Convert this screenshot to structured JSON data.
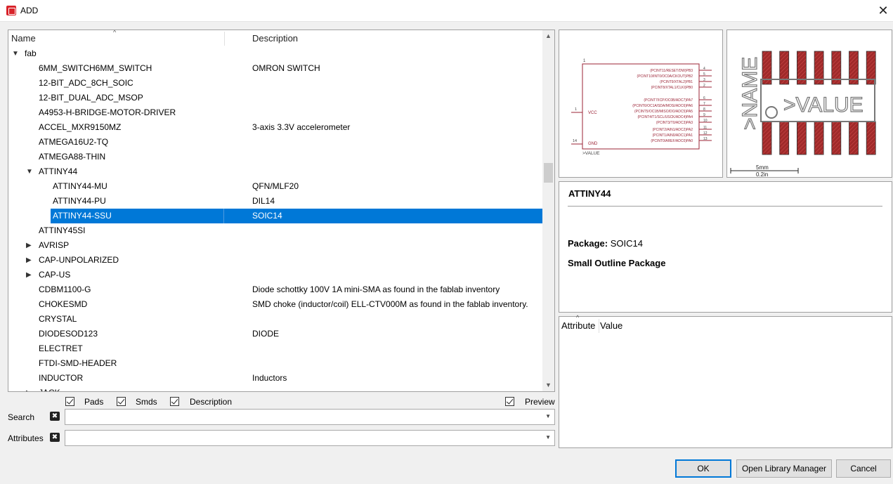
{
  "window": {
    "title": "ADD",
    "icon": "eagle-app-icon",
    "close": "✕"
  },
  "tree": {
    "columns": {
      "name": "Name",
      "description": "Description"
    },
    "rows": [
      {
        "name": "fab",
        "desc": "",
        "level": 0,
        "arrow": "down"
      },
      {
        "name": "6MM_SWITCH6MM_SWITCH",
        "desc": "OMRON SWITCH",
        "level": 1
      },
      {
        "name": "12-BIT_ADC_8CH_SOIC",
        "desc": "",
        "level": 1
      },
      {
        "name": "12-BIT_DUAL_ADC_MSOP",
        "desc": "",
        "level": 1
      },
      {
        "name": "A4953-H-BRIDGE-MOTOR-DRIVER",
        "desc": "",
        "level": 1
      },
      {
        "name": "ACCEL_MXR9150MZ",
        "desc": "3-axis 3.3V accelerometer",
        "level": 1
      },
      {
        "name": "ATMEGA16U2-TQ",
        "desc": "",
        "level": 1
      },
      {
        "name": "ATMEGA88-THIN",
        "desc": "",
        "level": 1
      },
      {
        "name": "ATTINY44",
        "desc": "",
        "level": 1,
        "arrow": "down"
      },
      {
        "name": "ATTINY44-MU",
        "desc": "QFN/MLF20",
        "level": 2
      },
      {
        "name": "ATTINY44-PU",
        "desc": "DIL14",
        "level": 2
      },
      {
        "name": "ATTINY44-SSU",
        "desc": "SOIC14",
        "level": 2,
        "selected": true
      },
      {
        "name": "ATTINY45SI",
        "desc": "",
        "level": 1
      },
      {
        "name": "AVRISP",
        "desc": "",
        "level": 1,
        "arrow": "right"
      },
      {
        "name": "CAP-UNPOLARIZED",
        "desc": "",
        "level": 1,
        "arrow": "right"
      },
      {
        "name": "CAP-US",
        "desc": "",
        "level": 1,
        "arrow": "right"
      },
      {
        "name": "CDBM1100-G",
        "desc": "Diode schottky 100V 1A mini-SMA as found in the fablab inventory",
        "level": 1
      },
      {
        "name": "CHOKESMD",
        "desc": "SMD choke (inductor/coil) ELL-CTV000M as found in the fablab inventory.",
        "level": 1
      },
      {
        "name": "CRYSTAL",
        "desc": "",
        "level": 1
      },
      {
        "name": "DIODESOD123",
        "desc": "DIODE",
        "level": 1
      },
      {
        "name": "ELECTRET",
        "desc": "",
        "level": 1
      },
      {
        "name": "FTDI-SMD-HEADER",
        "desc": "",
        "level": 1
      },
      {
        "name": "INDUCTOR",
        "desc": "Inductors",
        "level": 1
      },
      {
        "name": "JACK",
        "desc": "",
        "level": 1,
        "arrow": "right"
      }
    ]
  },
  "filters": {
    "pads": "Pads",
    "smds": "Smds",
    "description": "Description",
    "preview": "Preview"
  },
  "search": {
    "label": "Search",
    "value": ""
  },
  "attributes": {
    "label": "Attributes",
    "value": ""
  },
  "schematic": {
    "pin_top": "1",
    "right_pins": [
      {
        "num": "4",
        "label": "(PCINT11/RESET/DW)PB3"
      },
      {
        "num": "5",
        "label": "(PCINT10/INT0/OC0A/CKOUT)PB2"
      },
      {
        "num": "3",
        "label": "(PCINT9/XTAL2)PB1"
      },
      {
        "num": "2",
        "label": "(PCINT8/XTAL1/CLKI)PB0"
      },
      {
        "num": "6",
        "label": "(PCINT7/ICP/OC0B/ADC7)PA7"
      },
      {
        "num": "7",
        "label": "(PCINT6/OC1A/SDA/MOSI/ADC6)PA6"
      },
      {
        "num": "8",
        "label": "(PCINT5/OC1B/MISO/DO/ADC5)PA5"
      },
      {
        "num": "9",
        "label": "(PCINT4/T1/SCL/USCK/ADC4)PA4"
      },
      {
        "num": "10",
        "label": "(PCINT3/T0/ADC3)PA3"
      },
      {
        "num": "11",
        "label": "(PCINT2/AIN1/ADC2)PA2"
      },
      {
        "num": "12",
        "label": "(PCINT1/AIN0/ADC1)PA1"
      },
      {
        "num": "13",
        "label": "(PCINT0/AREF/ADC0)PA0"
      }
    ],
    "vcc_num": "1",
    "vcc": "VCC",
    "gnd_num": "14",
    "gnd": "GND",
    "value": ">VALUE"
  },
  "footprint": {
    "name": ">NAME",
    "value": ">VALUE",
    "scale_mm": "5mm",
    "scale_in": "0.2in"
  },
  "details": {
    "title": "ATTINY44",
    "package_label": "Package:",
    "package_value": "SOIC14",
    "package_desc": "Small Outline Package"
  },
  "attr_table": {
    "attribute": "Attribute",
    "value": "Value"
  },
  "buttons": {
    "ok": "OK",
    "library_manager": "Open Library Manager",
    "cancel": "Cancel"
  }
}
